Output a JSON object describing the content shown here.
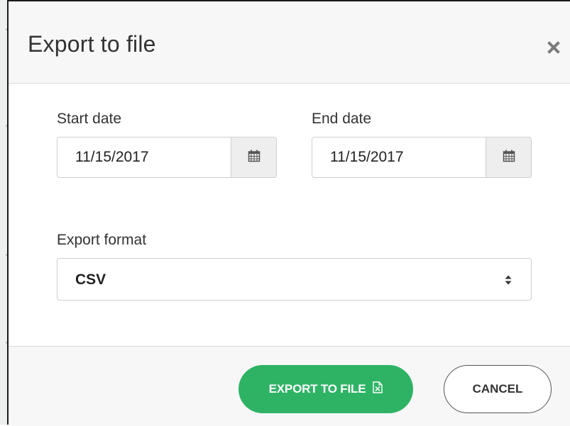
{
  "dialog": {
    "title": "Export to file",
    "close_icon": "close-icon"
  },
  "start_date": {
    "label": "Start date",
    "value": "11/15/2017",
    "icon": "calendar-icon"
  },
  "end_date": {
    "label": "End date",
    "value": "11/15/2017",
    "icon": "calendar-icon"
  },
  "export_format": {
    "label": "Export format",
    "selected": "CSV",
    "icon": "sort-caret-icon"
  },
  "footer": {
    "export_label": "EXPORT TO FILE",
    "export_icon": "excel-file-icon",
    "cancel_label": "CANCEL"
  },
  "colors": {
    "primary": "#2eb365",
    "header_bg": "#f7f7f7",
    "addon_bg": "#eeeeee",
    "border": "#cfcfcf",
    "text": "#333333"
  }
}
